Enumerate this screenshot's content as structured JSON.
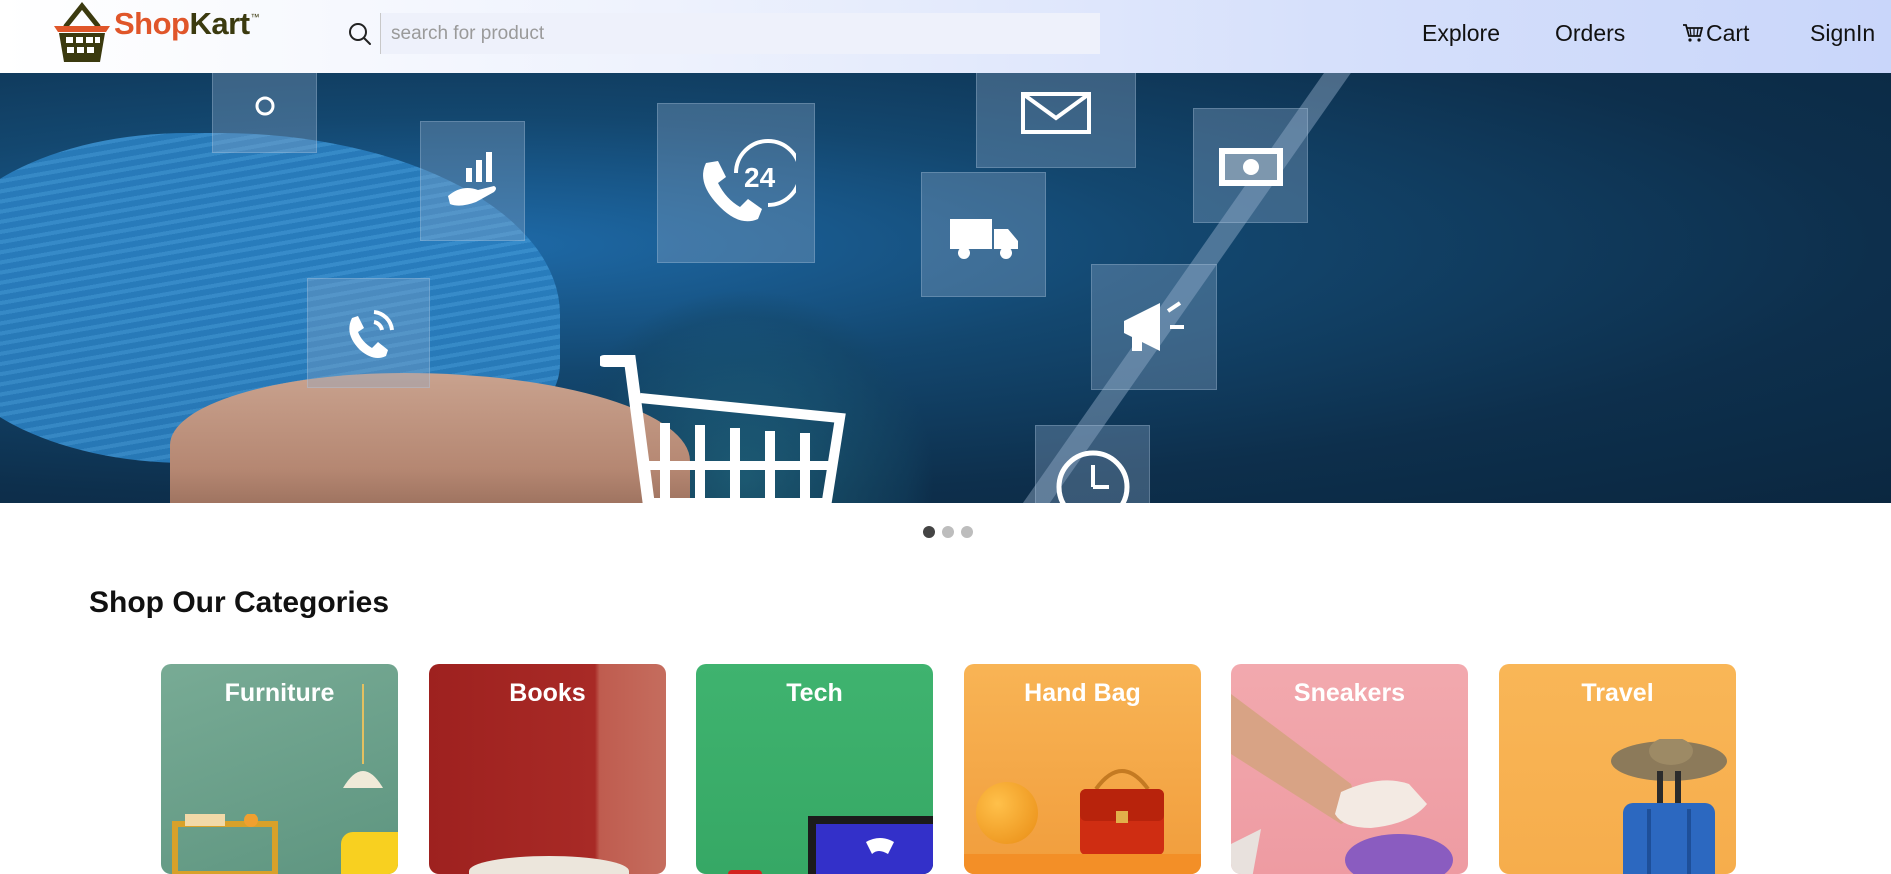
{
  "brand": {
    "name_part1": "Shop",
    "name_part2": "Kart",
    "tm": "™"
  },
  "search": {
    "placeholder": "search for product",
    "value": ""
  },
  "nav": {
    "explore": "Explore",
    "orders": "Orders",
    "cart": "Cart",
    "signin": "SignIn"
  },
  "hero": {
    "slide_count": 3,
    "active_slide": 1,
    "badge_24": "24"
  },
  "categories_section": {
    "title": "Shop Our Categories",
    "items": [
      {
        "label": "Furniture",
        "color": "#6fa58e"
      },
      {
        "label": "Books",
        "color": "#a82a26"
      },
      {
        "label": "Tech",
        "color": "#3fb36f"
      },
      {
        "label": "Hand Bag",
        "color": "#f4a84a"
      },
      {
        "label": "Sneakers",
        "color": "#f0a0a7"
      },
      {
        "label": "Travel",
        "color": "#f9b657"
      }
    ]
  }
}
